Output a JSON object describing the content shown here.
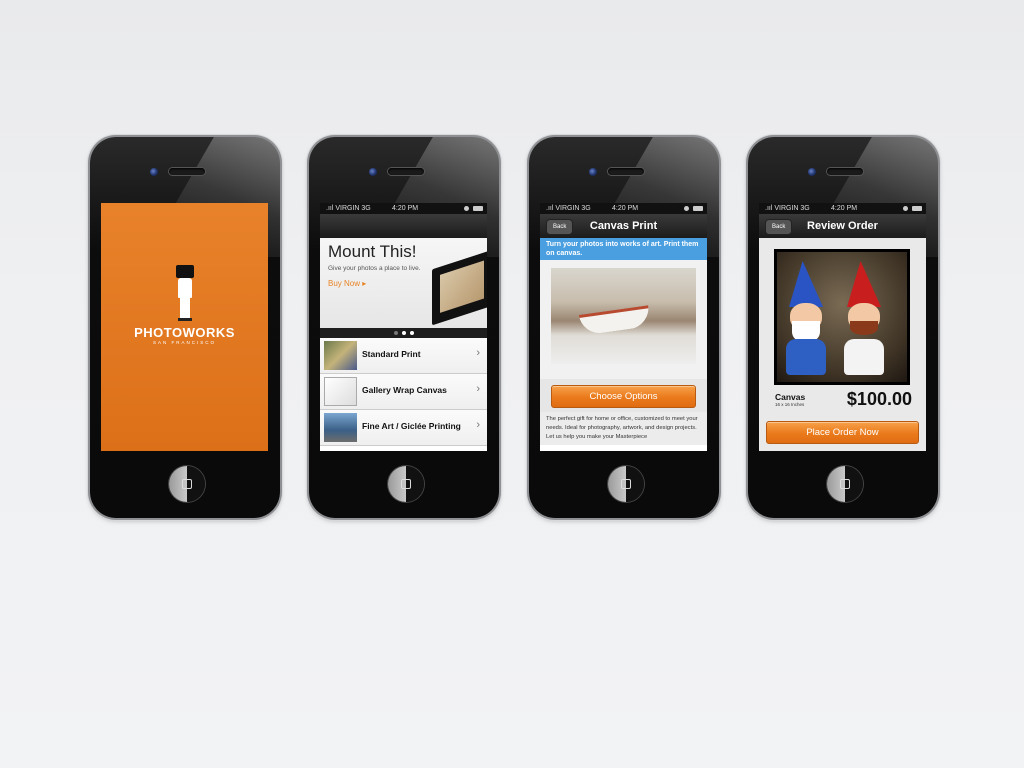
{
  "statusbar": {
    "carrier": ".ııl VIRGIN  3G",
    "time": "4:20 PM"
  },
  "splash": {
    "logo": "PHOTOWORKS",
    "subtitle": "SAN FRANCISCO"
  },
  "screen2": {
    "banner_title": "Mount This!",
    "banner_tagline": "Give your photos a place to live.",
    "buy_now": "Buy Now ▸",
    "items": [
      {
        "label": "Standard Print"
      },
      {
        "label": "Gallery Wrap Canvas"
      },
      {
        "label": "Fine Art / Giclée Printing"
      }
    ]
  },
  "screen3": {
    "back": "Back",
    "title": "Canvas Print",
    "promo": "Turn your photos into works of art. Print them on canvas.",
    "button": "Choose Options",
    "description": "The perfect gift for home or office, customized to meet your needs. Ideal for photography, artwork, and design projects. Let us help you make your Masterpiece"
  },
  "screen4": {
    "back": "Back",
    "title": "Review Order",
    "product": "Canvas",
    "size": "16 x 16 Inches",
    "price": "$100.00",
    "button": "Place Order Now"
  },
  "colors": {
    "accent_orange": "#e8822a",
    "promo_blue": "#4a9fe0"
  }
}
